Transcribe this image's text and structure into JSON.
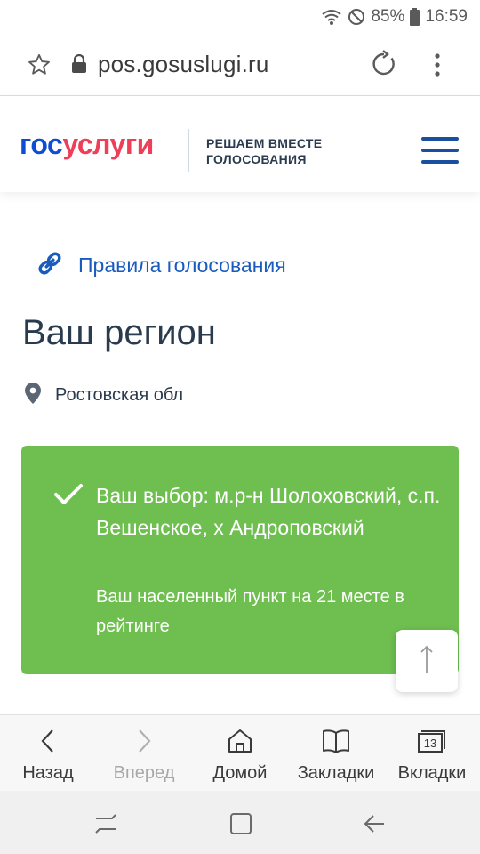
{
  "status_bar": {
    "battery": "85%",
    "time": "16:59"
  },
  "browser": {
    "url": "pos.gosuslugi.ru"
  },
  "site_header": {
    "logo_part1": "гос",
    "logo_part2": "услуги",
    "tagline_line1": "РЕШАЕМ ВМЕСТЕ",
    "tagline_line2": "ГОЛОСОВАНИЯ"
  },
  "main": {
    "rules_link": "Правила голосования",
    "title": "Ваш регион",
    "region": "Ростовская обл",
    "choice": "Ваш выбор: м.р-н Шолоховский, с.п. Вешенское, х Андроповский",
    "rating": "Ваш населенный пункт на 21 месте в рейтинге"
  },
  "browser_nav": {
    "back": "Назад",
    "forward": "Вперед",
    "home": "Домой",
    "bookmarks": "Закладки",
    "tabs": "Вкладки",
    "tabs_count": "13"
  },
  "colors": {
    "brand_blue": "#0d4cd3",
    "brand_red": "#ee3f58",
    "success_green": "#6ebf50",
    "link_blue": "#1a5cbe"
  }
}
